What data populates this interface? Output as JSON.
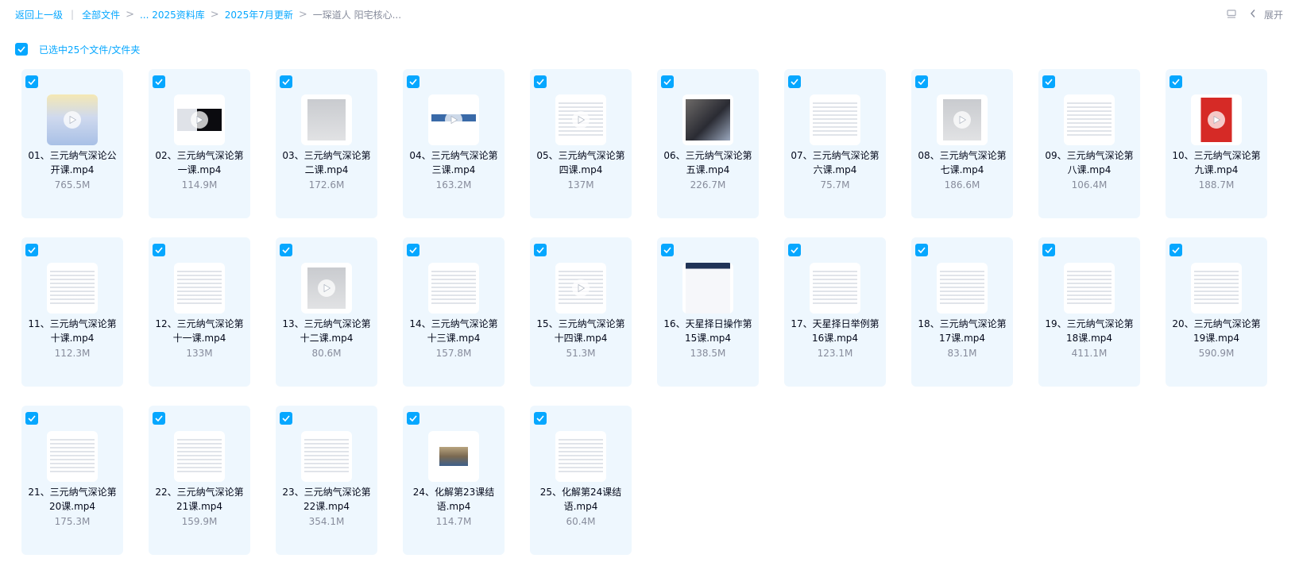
{
  "breadcrumb": {
    "back": "返回上一级",
    "all_files": "全部文件",
    "ellipsis_folder": "... 2025资料库",
    "month_folder": "2025年7月更新",
    "current": "一琛道人 阳宅核心..."
  },
  "toolbar": {
    "expand_label": "展开"
  },
  "selection": {
    "label": "已选中25个文件/文件夹"
  },
  "colors": {
    "accent": "#06a7ff",
    "card_bg": "#eef7fe",
    "muted_text": "#878c9c"
  },
  "files": [
    {
      "name": "01、三元纳气深论公开课.mp4",
      "size": "765.5M",
      "thumb": "sky",
      "play": true
    },
    {
      "name": "02、三元纳气深论第一课.mp4",
      "size": "114.9M",
      "thumb": "dark",
      "play": true
    },
    {
      "name": "03、三元纳气深论第二课.mp4",
      "size": "172.6M",
      "thumb": "gray",
      "play": false
    },
    {
      "name": "04、三元纳气深论第三课.mp4",
      "size": "163.2M",
      "thumb": "board",
      "play": true
    },
    {
      "name": "05、三元纳气深论第四课.mp4",
      "size": "137M",
      "thumb": "text",
      "play": true
    },
    {
      "name": "06、三元纳气深论第五课.mp4",
      "size": "226.7M",
      "thumb": "photo",
      "play": false
    },
    {
      "name": "07、三元纳气深论第六课.mp4",
      "size": "75.7M",
      "thumb": "text",
      "play": false
    },
    {
      "name": "08、三元纳气深论第七课.mp4",
      "size": "186.6M",
      "thumb": "gray",
      "play": true
    },
    {
      "name": "09、三元纳气深论第八课.mp4",
      "size": "106.4M",
      "thumb": "text",
      "play": false
    },
    {
      "name": "10、三元纳气深论第九课.mp4",
      "size": "188.7M",
      "thumb": "red",
      "play": true
    },
    {
      "name": "11、三元纳气深论第十课.mp4",
      "size": "112.3M",
      "thumb": "text",
      "play": false
    },
    {
      "name": "12、三元纳气深论第十一课.mp4",
      "size": "133M",
      "thumb": "text",
      "play": false
    },
    {
      "name": "13、三元纳气深论第十二课.mp4",
      "size": "80.6M",
      "thumb": "gray",
      "play": true
    },
    {
      "name": "14、三元纳气深论第十三课.mp4",
      "size": "157.8M",
      "thumb": "text",
      "play": false
    },
    {
      "name": "15、三元纳气深论第十四课.mp4",
      "size": "51.3M",
      "thumb": "text",
      "play": true
    },
    {
      "name": "16、天星择日操作第15课.mp4",
      "size": "138.5M",
      "thumb": "book",
      "play": false
    },
    {
      "name": "17、天星择日举例第16课.mp4",
      "size": "123.1M",
      "thumb": "text",
      "play": false
    },
    {
      "name": "18、三元纳气深论第17课.mp4",
      "size": "83.1M",
      "thumb": "text",
      "play": false
    },
    {
      "name": "19、三元纳气深论第18课.mp4",
      "size": "411.1M",
      "thumb": "text",
      "play": false
    },
    {
      "name": "20、三元纳气深论第19课.mp4",
      "size": "590.9M",
      "thumb": "text",
      "play": false
    },
    {
      "name": "21、三元纳气深论第20课.mp4",
      "size": "175.3M",
      "thumb": "text",
      "play": false
    },
    {
      "name": "22、三元纳气深论第21课.mp4",
      "size": "159.9M",
      "thumb": "text",
      "play": false
    },
    {
      "name": "23、三元纳气深论第22课.mp4",
      "size": "354.1M",
      "thumb": "text",
      "play": false
    },
    {
      "name": "24、化解第23课结语.mp4",
      "size": "114.7M",
      "thumb": "room",
      "play": false
    },
    {
      "name": "25、化解第24课结语.mp4",
      "size": "60.4M",
      "thumb": "text",
      "play": false
    }
  ]
}
